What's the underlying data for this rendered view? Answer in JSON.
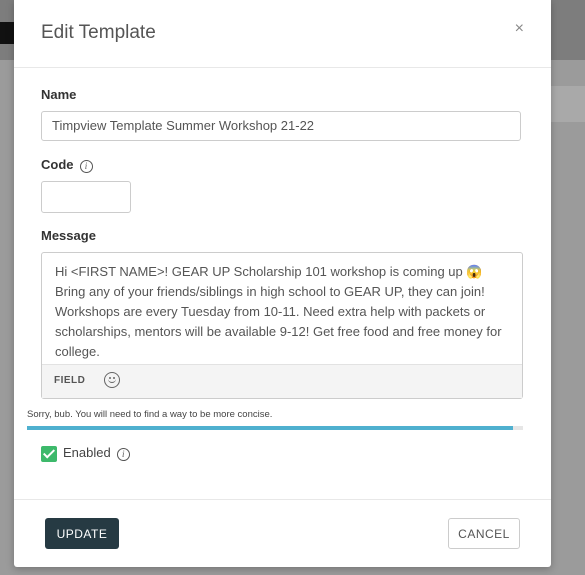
{
  "modal": {
    "title": "Edit Template",
    "close_symbol": "×"
  },
  "form": {
    "name_label": "Name",
    "name_value": "Timpview Template Summer Workshop 21-22",
    "code_label": "Code",
    "code_value": "",
    "message_label": "Message",
    "message_value": "Hi <FIRST NAME>! GEAR UP Scholarship 101 workshop is coming up 😱 Bring any of your friends/siblings in high school to GEAR UP, they can join! Workshops are every Tuesday from 10-11. Need extra help with packets or scholarships, mentors will be available 9-12! Get free food and free money for college.",
    "toolbar_field_label": "FIELD",
    "warning_text": "Sorry, bub. You will need to find a way to be more concise.",
    "length_progress": 0.98,
    "enabled_label": "Enabled",
    "enabled_checked": true
  },
  "footer": {
    "update_label": "UPDATE",
    "cancel_label": "CANCEL"
  },
  "icons": {
    "info": "info-icon",
    "emoji": "smiley-icon",
    "close": "close-icon",
    "check": "check-icon"
  },
  "colors": {
    "primary_button": "#263a43",
    "progress": "#4fb0cf",
    "checkbox": "#3db96b"
  }
}
